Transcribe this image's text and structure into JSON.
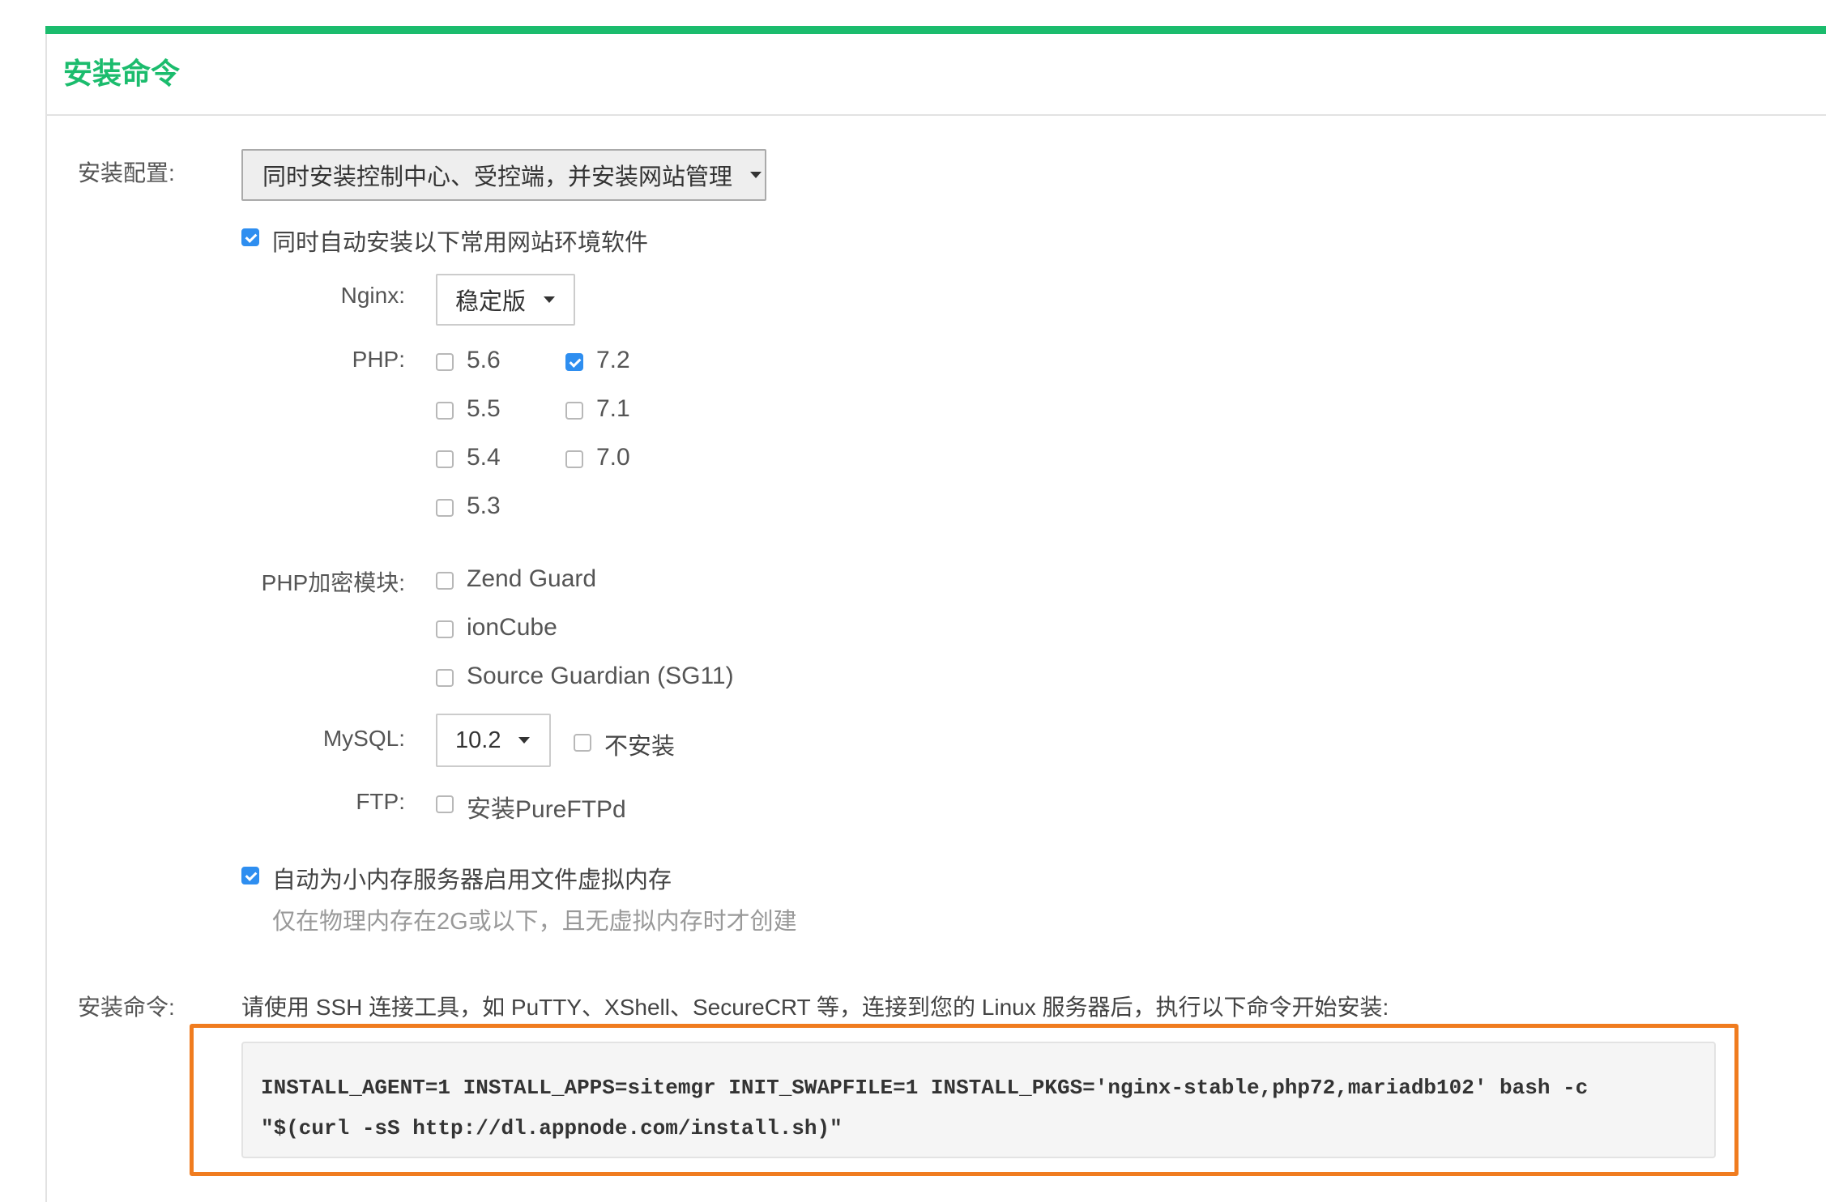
{
  "panel": {
    "title": "安装命令"
  },
  "config": {
    "label": "安装配置:",
    "selected": "同时安装控制中心、受控端，并安装网站管理",
    "auto_install": {
      "checked": true,
      "label": "同时自动安装以下常用网站环境软件"
    }
  },
  "nginx": {
    "label": "Nginx:",
    "selected": "稳定版"
  },
  "php": {
    "label": "PHP:",
    "versions": [
      {
        "label": "5.6",
        "checked": false
      },
      {
        "label": "7.2",
        "checked": true
      },
      {
        "label": "5.5",
        "checked": false
      },
      {
        "label": "7.1",
        "checked": false
      },
      {
        "label": "5.4",
        "checked": false
      },
      {
        "label": "7.0",
        "checked": false
      },
      {
        "label": "5.3",
        "checked": false
      }
    ]
  },
  "php_encrypt": {
    "label": "PHP加密模块:",
    "modules": [
      {
        "label": "Zend Guard",
        "checked": false
      },
      {
        "label": "ionCube",
        "checked": false
      },
      {
        "label": "Source Guardian (SG11)",
        "checked": false
      }
    ]
  },
  "mysql": {
    "label": "MySQL:",
    "selected": "10.2",
    "no_install": {
      "label": "不安装",
      "checked": false
    }
  },
  "ftp": {
    "label": "FTP:",
    "option": {
      "label": "安装PureFTPd",
      "checked": false
    }
  },
  "swap": {
    "checked": true,
    "label": "自动为小内存服务器启用文件虚拟内存",
    "hint": "仅在物理内存在2G或以下，且无虚拟内存时才创建"
  },
  "command": {
    "label": "安装命令:",
    "instruction": "请使用 SSH 连接工具，如 PuTTY、XShell、SecureCRT 等，连接到您的 Linux 服务器后，执行以下命令开始安装:",
    "line1": "INSTALL_AGENT=1 INSTALL_APPS=sitemgr INIT_SWAPFILE=1 INSTALL_PKGS='nginx-stable,php72,mariadb102' bash -c",
    "line2": "\"$(curl -sS http://dl.appnode.com/install.sh)\""
  },
  "colors": {
    "accent": "#1bbc6d",
    "checkbox": "#2e8ef0",
    "highlight": "#f07c1f"
  }
}
